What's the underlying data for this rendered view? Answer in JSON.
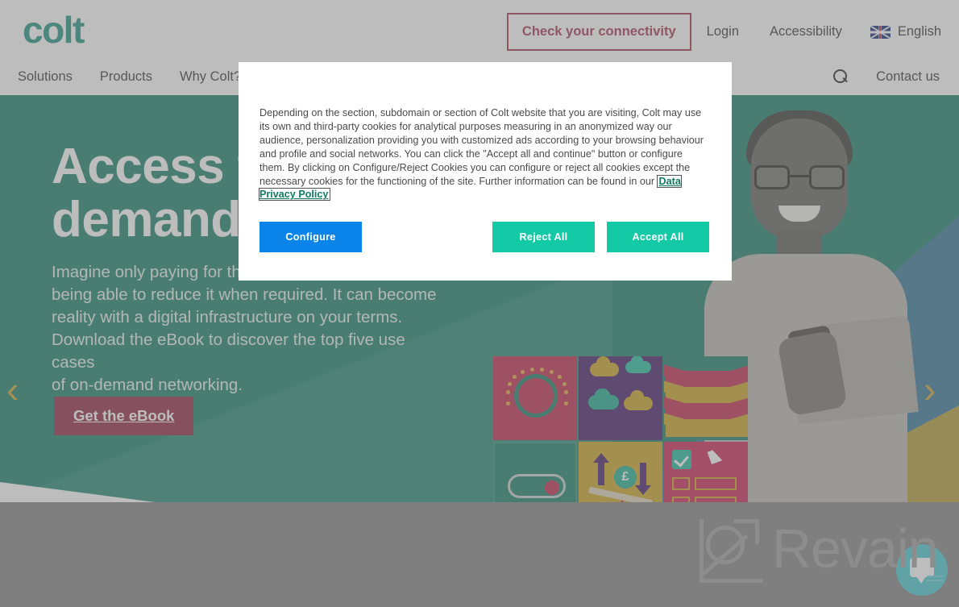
{
  "header": {
    "logo_text": "colt",
    "cta_label": "Check your connectivity",
    "login_label": "Login",
    "accessibility_label": "Accessibility",
    "language_label": "English",
    "nav_items": [
      {
        "label": "Solutions"
      },
      {
        "label": "Products"
      },
      {
        "label": "Why Colt?"
      }
    ],
    "search_icon": "search-icon",
    "contact_label": "Contact us",
    "flag_icon": "uk-flag-icon",
    "accent_green": "#118f77",
    "accent_red": "#9f2b45"
  },
  "hero": {
    "title": "Access the on-demand revolution",
    "title_visible_line1": "Access th",
    "title_visible_line2": "demand r",
    "body": "Imagine only paying for the bandwidth you need and being able to reduce it when required. It can become reality with a digital infrastructure on your terms. Download the eBook to discover the top five use cases of on-demand networking.",
    "body_visible": "Imagine only paying for the\nbeing able to reduce it when required. It can become\nreality with a digital infrastructure on your terms.\nDownload the eBook to discover the top five use cases\nof on-demand networking.",
    "cta_label": "Get the eBook",
    "prev_arrow": "chevron-left-icon",
    "next_arrow": "chevron-right-icon",
    "bg_color": "#0e7a63",
    "cta_color": "#8c1d3c",
    "tiles": [
      {
        "name": "dial-gauge-tile",
        "color": "#c01f45"
      },
      {
        "name": "cloud-tile",
        "color": "#3c0f63"
      },
      {
        "name": "chevrons-tile",
        "color": "#0e7a63"
      },
      {
        "name": "toggle-switch-tile",
        "color": "#0e7a63"
      },
      {
        "name": "cost-balance-tile",
        "color": "#c8a21a",
        "currency_symbol": "£"
      },
      {
        "name": "checklist-tile",
        "color": "#c8194d"
      }
    ]
  },
  "cookie_modal": {
    "body": "Depending on the section, subdomain or section of Colt website that you are visiting, Colt may use its own and third-party cookies for analytical purposes measuring in an anonymized way our audience, personalization providing you with customized ads according to your browsing behaviour and profile and social networks. You can click the \"Accept all and continue\" button or configure them. By clicking on Configure/Reject Cookies you can configure or reject all cookies except the necessary cookies for the functioning of the site. Further information can be found in our ",
    "policy_link_label": "Data Privacy Policy",
    "configure_label": "Configure",
    "reject_label": "Reject All",
    "accept_label": "Accept All",
    "configure_color": "#0a84e8",
    "action_color": "#14c9a5"
  },
  "watermark": {
    "brand": "Revain",
    "mark_icon": "revain-logo-icon"
  },
  "chat_widget": {
    "icon": "chat-bubble-icon",
    "color": "#3ec6d0"
  }
}
